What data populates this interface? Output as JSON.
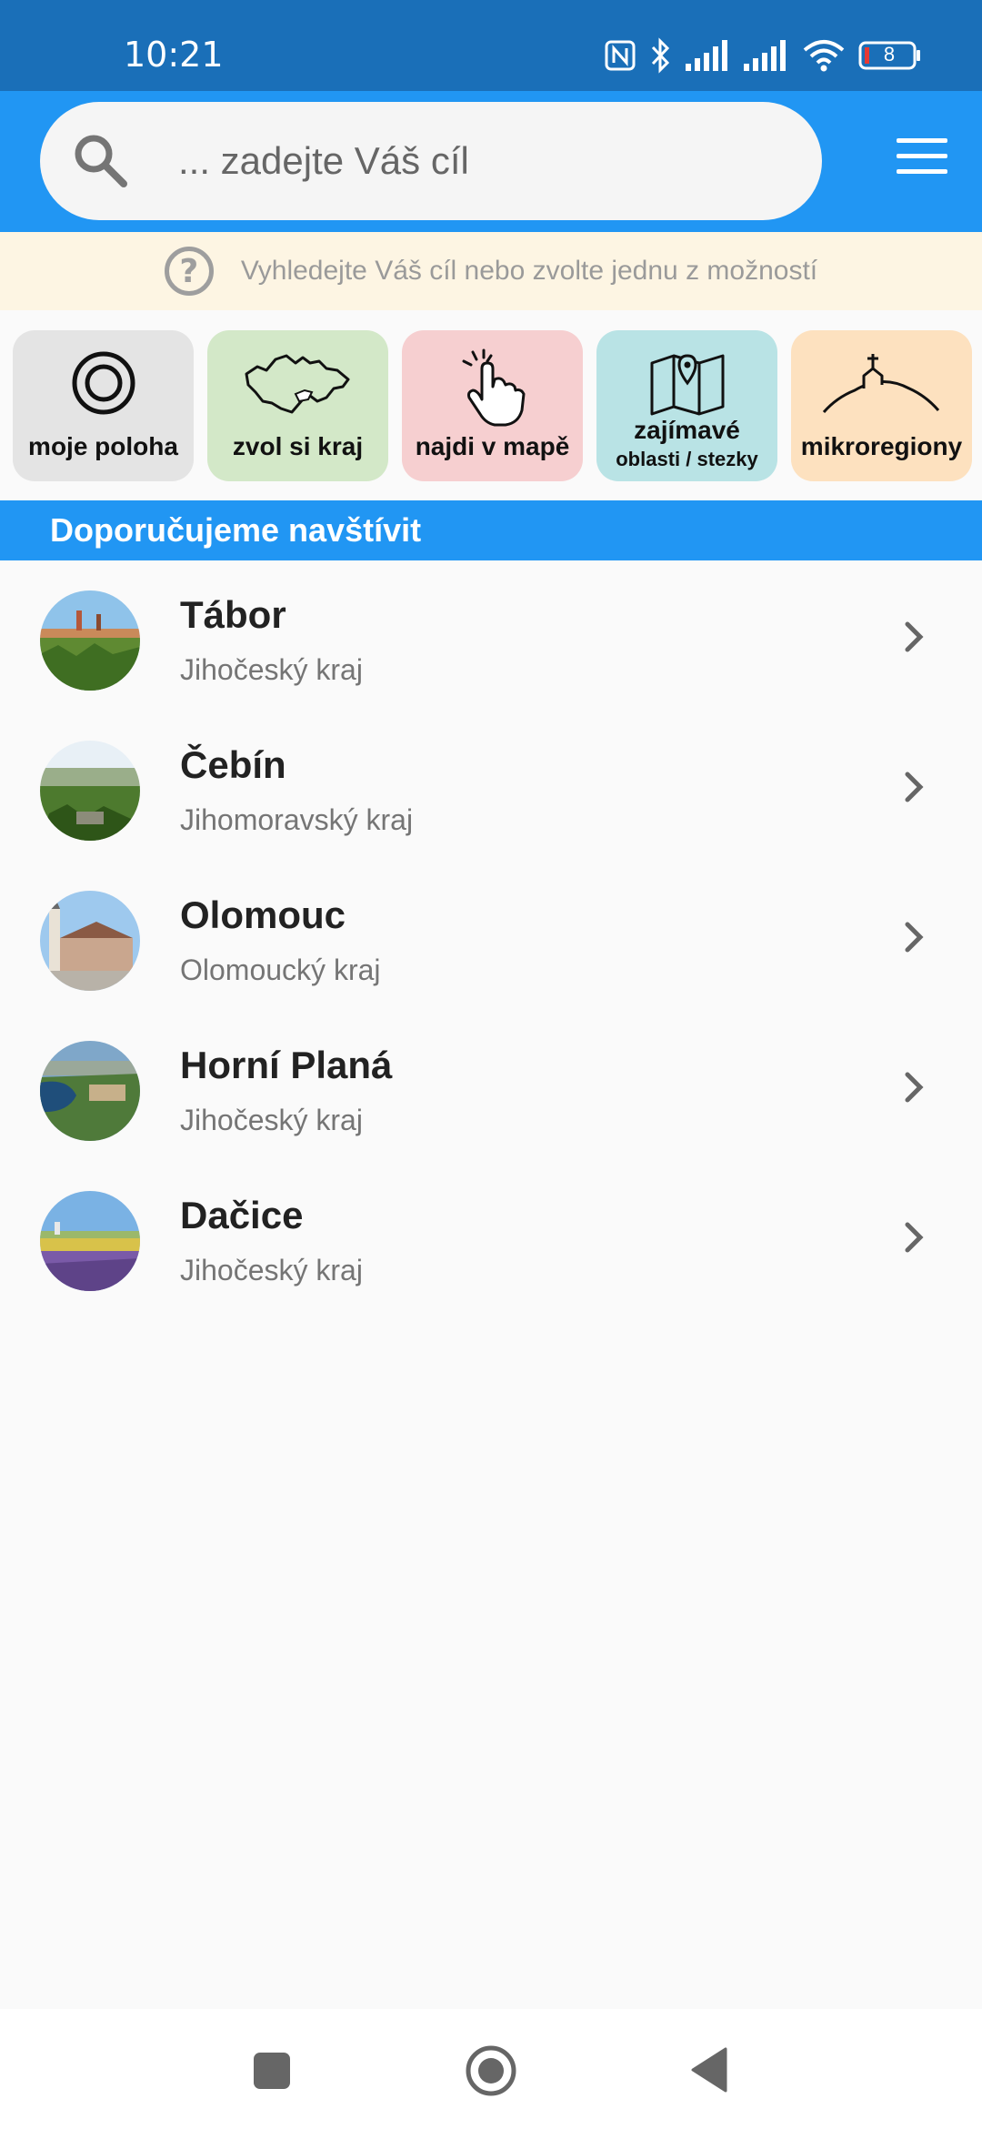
{
  "status_bar": {
    "time": "10:21",
    "battery_level": "8",
    "icons": [
      "nfc-icon",
      "bluetooth-icon",
      "signal-icon",
      "signal-icon",
      "wifi-icon",
      "battery-icon"
    ]
  },
  "search": {
    "placeholder": "... zadejte Váš cíl",
    "icon": "search-icon"
  },
  "menu_icon": "hamburger-menu-icon",
  "hint": {
    "text": "Vyhledejte Váš cíl nebo zvolte jednu z možností",
    "icon": "question-circle-icon"
  },
  "tiles": [
    {
      "label": "moje poloha",
      "icon": "location-target-icon",
      "color": "#e4e4e4"
    },
    {
      "label": "zvol si kraj",
      "icon": "czech-map-icon",
      "color": "#d3e8c8"
    },
    {
      "label": "najdi v mapě",
      "icon": "tap-hand-icon",
      "color": "#f6cfd0"
    },
    {
      "label": "zajímavé",
      "sublabel": "oblasti / stezky",
      "icon": "folded-map-pin-icon",
      "color": "#b9e3e5"
    },
    {
      "label": "mikroregiony",
      "icon": "hill-chapel-icon",
      "color": "#fde1bf"
    }
  ],
  "section": {
    "title": "Doporučujeme navštívit"
  },
  "places": [
    {
      "name": "Tábor",
      "region": "Jihočeský kraj"
    },
    {
      "name": "Čebín",
      "region": "Jihomoravský kraj"
    },
    {
      "name": "Olomouc",
      "region": "Olomoucký kraj"
    },
    {
      "name": "Horní Planá",
      "region": "Jihočeský kraj"
    },
    {
      "name": "Dačice",
      "region": "Jihočeský kraj"
    }
  ],
  "nav": [
    "recents-square-icon",
    "home-circle-icon",
    "back-triangle-icon"
  ],
  "colors": {
    "status_bar": "#1a6fb8",
    "app_bar": "#2196f3",
    "hint_bg": "#fdf5e3"
  }
}
